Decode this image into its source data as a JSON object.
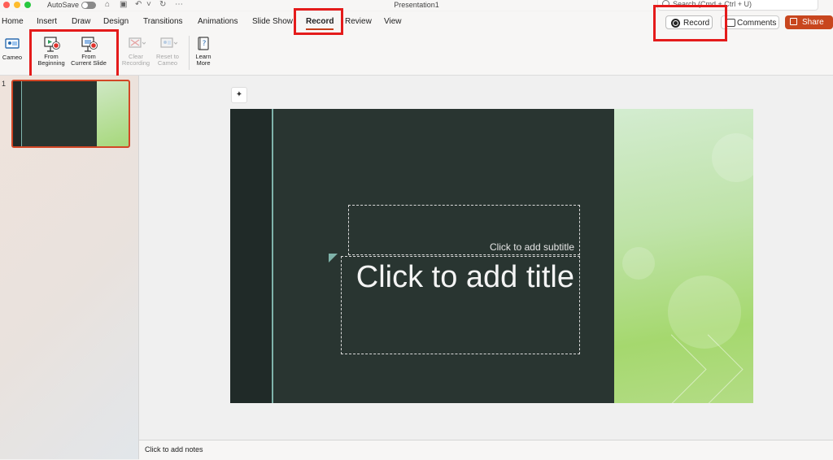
{
  "titlebar": {
    "autosave_label": "AutoSave",
    "autosave_on": false,
    "document_title": "Presentation1",
    "search_placeholder": "Search (Cmd + Ctrl + U)",
    "traffic_lights": [
      "#ff5f57",
      "#febc2e",
      "#28c840"
    ]
  },
  "tabs": [
    {
      "label": "Home"
    },
    {
      "label": "Insert"
    },
    {
      "label": "Draw"
    },
    {
      "label": "Design"
    },
    {
      "label": "Transitions"
    },
    {
      "label": "Animations"
    },
    {
      "label": "Slide Show"
    },
    {
      "label": "Record",
      "active": true
    },
    {
      "label": "Review"
    },
    {
      "label": "View"
    }
  ],
  "header_actions": {
    "record_label": "Record",
    "comments_label": "Comments",
    "share_label": "Share"
  },
  "ribbon": {
    "cameo": "Cameo",
    "from_beginning": [
      "From",
      "Beginning"
    ],
    "from_current_slide": [
      "From",
      "Current Slide"
    ],
    "clear_recording": [
      "Clear",
      "Recording"
    ],
    "reset_to_cameo": [
      "Reset to",
      "Cameo"
    ],
    "learn_more": [
      "Learn",
      "More"
    ]
  },
  "thumbnails": {
    "slide_number": "1"
  },
  "slide": {
    "subtitle_placeholder": "Click to add subtitle",
    "title_placeholder": "Click to add title"
  },
  "notes": {
    "placeholder": "Click to add notes"
  },
  "colors": {
    "accent": "#c43e1c",
    "highlight_box": "#e41b1b",
    "slide_dark": "#293531",
    "slide_green": "#a5d86e"
  }
}
